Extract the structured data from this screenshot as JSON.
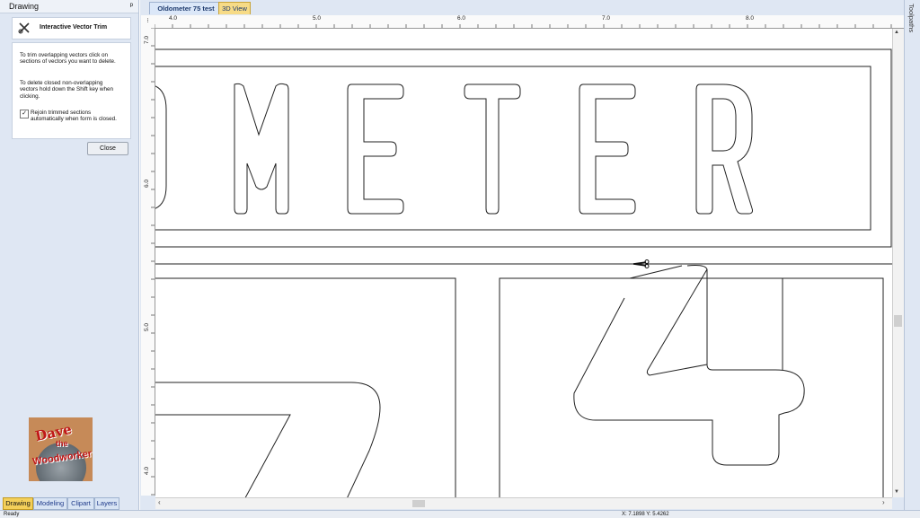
{
  "panel": {
    "title": "Drawing",
    "pin": "ᵖ",
    "tool_title": "Interactive Vector Trim",
    "help_p1": "To trim overlapping vectors click on sections of vectors you want to delete.",
    "help_p2": "To delete closed non-overlapping vectors hold down the Shift key when clicking.",
    "checkbox_label": "Rejoin trimmed sections automatically when form is closed.",
    "checkbox_checked": true,
    "checkbox_mark": "✓",
    "close_label": "Close"
  },
  "logo": {
    "w1": "Dave",
    "w2": "the",
    "w3": "Woodworker"
  },
  "bottom_tabs": [
    "Drawing",
    "Modeling",
    "Clipart",
    "Layers"
  ],
  "doc_tabs": {
    "active": "Oldometer 75 test",
    "other": "3D View"
  },
  "ruler": {
    "top_labels": [
      "4.0",
      "5.0",
      "6.0",
      "7.0",
      "8.0"
    ],
    "left_labels": [
      "7.0",
      "6.0",
      "5.0",
      "4.0"
    ]
  },
  "side_tab": "Toolpaths",
  "status": {
    "ready": "Ready",
    "coords": "X: 7.1898 Y: 5.4262"
  },
  "colors": {
    "active_tab": "#f4d05a",
    "panel_bg": "#dfe7f3",
    "vector_stroke": "#222222"
  },
  "icons": {
    "tool": "trim-scissors-icon",
    "cursor": "scissors-cursor-icon"
  }
}
